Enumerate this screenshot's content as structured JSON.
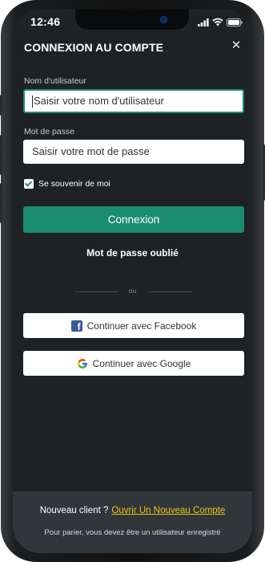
{
  "status_bar": {
    "time": "12:46"
  },
  "modal": {
    "title": "CONNEXION AU COMPTE",
    "close_icon": "close-icon",
    "username": {
      "label": "Nom d'utilisateur",
      "placeholder": "Saisir votre nom d'utilisateur"
    },
    "password": {
      "label": "Mot de passe",
      "placeholder": "Saisir votre mot de passe"
    },
    "remember_me": {
      "label": "Se souvenir de moi",
      "checked": true
    },
    "login_button": "Connexion",
    "forgot_password": "Mot de passe oublié",
    "divider_text": "ou",
    "facebook_button": "Continuer avec Facebook",
    "google_button": "Continuer avec Google"
  },
  "footer": {
    "new_client_text": "Nouveau client ?",
    "open_account_link": "Ouvrir Un Nouveau Compte",
    "note": "Pour parier, vous devez être un utilisateur enregistré"
  },
  "colors": {
    "background": "#1f2224",
    "accent": "#1b8d73",
    "link": "#f4c319",
    "footer_bg": "#30363a"
  }
}
